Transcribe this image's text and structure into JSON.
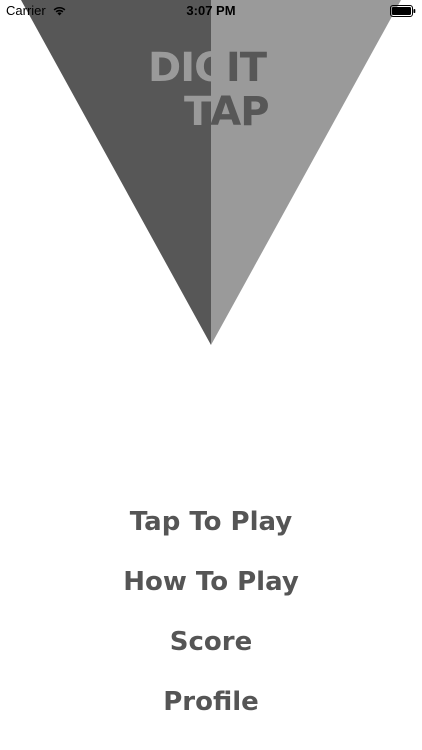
{
  "status_bar": {
    "carrier": "Carrier",
    "time": "3:07 PM",
    "icons": [
      "wifi-icon",
      "battery-icon"
    ]
  },
  "title": {
    "line1_left": "DIG",
    "line1_right": "IT",
    "line2_left": "T",
    "line2_right": "AP"
  },
  "colors": {
    "triangle_dark": "#575757",
    "triangle_light": "#9a9a9a",
    "title_on_dark": "#9a9a9a",
    "title_on_light": "#575757",
    "menu_text": "#555555"
  },
  "menu": {
    "items": [
      {
        "label": "Tap To Play"
      },
      {
        "label": "How To Play"
      },
      {
        "label": "Score"
      },
      {
        "label": "Profile"
      }
    ]
  }
}
